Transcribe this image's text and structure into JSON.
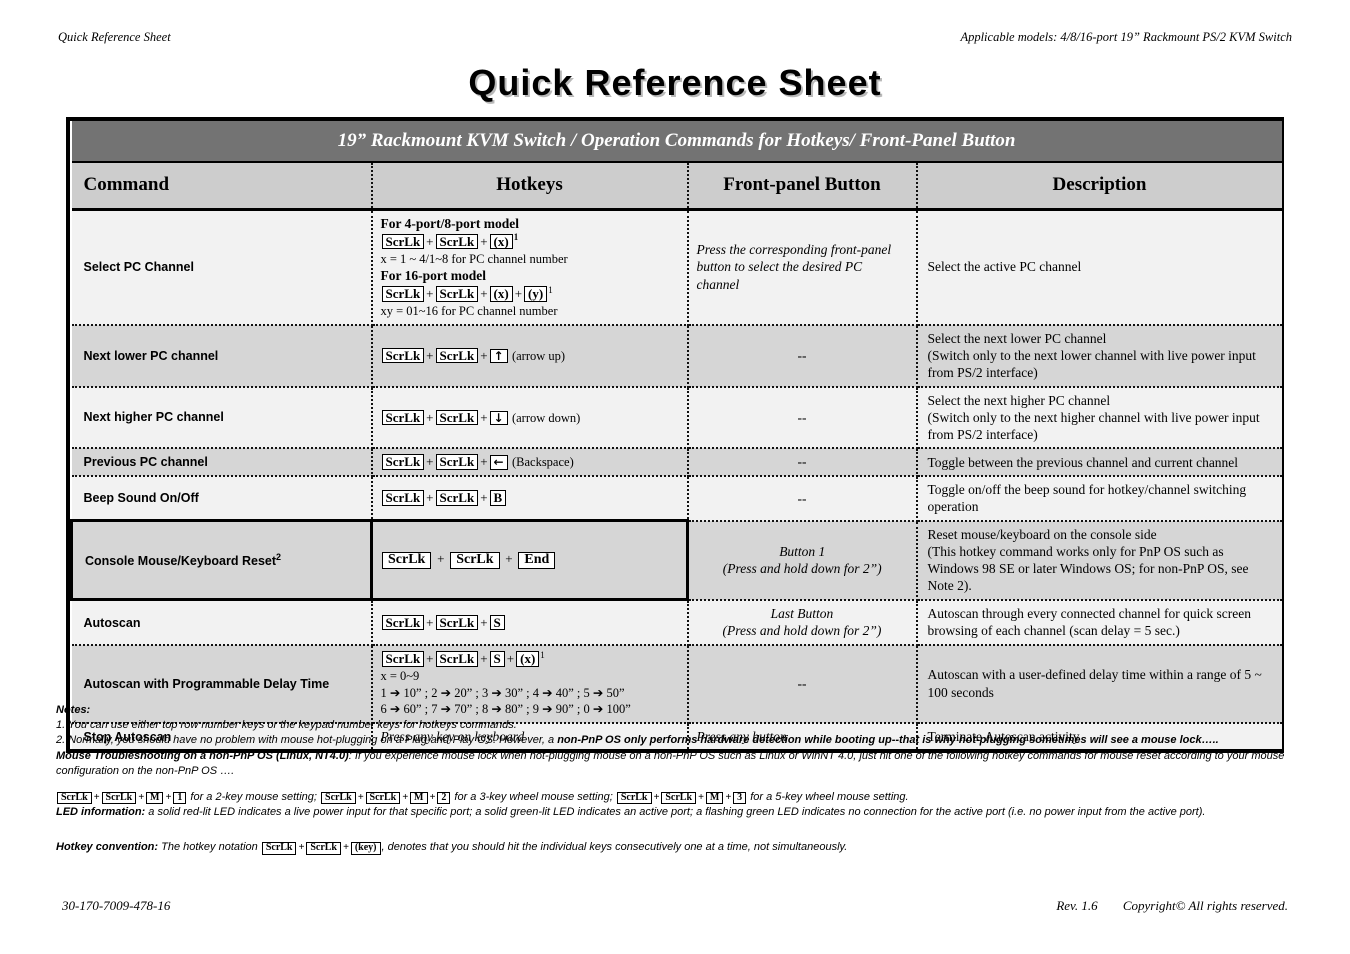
{
  "runhead": {
    "left": "Quick Reference Sheet",
    "right": "Applicable models: 4/8/16-port 19” Rackmount PS/2 KVM Switch"
  },
  "doc_title": "Quick   Reference   Sheet",
  "table": {
    "banner": "19” Rackmount KVM Switch  /  Operation   Commands for Hotkeys/  Front-Panel Button",
    "columns": [
      "Command",
      "Hotkeys",
      "Front-panel Button",
      "Description"
    ],
    "rows": [
      {
        "command": "Select PC Channel",
        "hotkeys": {
          "label1": "For 4-port/8-port model",
          "keys1": [
            "ScrLk",
            "ScrLk",
            "(x)"
          ],
          "sup1": "1",
          "note1": "x = 1 ~ 4/1~8  for PC channel number",
          "label2": "For 16-port model",
          "keys2": [
            "ScrLk",
            "ScrLk",
            "(x)",
            "(y)"
          ],
          "sup2": "1",
          "note2": "xy = 01~16  for PC channel number"
        },
        "front_panel": "Press the corresponding front-panel button  to select the desired PC channel",
        "front_panel_italic_part": "Press the corresponding",
        "description": "Select the active PC channel"
      },
      {
        "command": "Next lower PC channel",
        "keys": [
          "ScrLk",
          "ScrLk",
          "↑"
        ],
        "key_suffix": "(arrow up)",
        "front_panel": "--",
        "description": "Select the next lower PC channel\n(Switch only to the  next lower channel with live power input from PS/2 interface)"
      },
      {
        "command": "Next higher PC channel",
        "keys": [
          "ScrLk",
          "ScrLk",
          "↓"
        ],
        "key_suffix": "(arrow down)",
        "front_panel": "--",
        "description": "Select the next higher PC channel\n(Switch only to the  next higher channel with live power input from PS/2 interface)"
      },
      {
        "command": "Previous PC channel",
        "keys": [
          "ScrLk",
          "ScrLk",
          "←"
        ],
        "key_suffix": "(Backspace)",
        "front_panel": "--",
        "description": "Toggle between the previous channel and current channel"
      },
      {
        "command": "Beep Sound On/Off",
        "keys": [
          "ScrLk",
          "ScrLk",
          "B"
        ],
        "key_suffix": "",
        "front_panel": "--",
        "description": "Toggle on/off the beep sound for hotkey/channel switching operation"
      },
      {
        "command": "Console Mouse/Keyboard Reset",
        "command_sup": "2",
        "keys": [
          "ScrLk",
          "ScrLk",
          "End"
        ],
        "key_suffix": "",
        "front_panel": "Button 1",
        "front_panel2": "(Press and hold down for 2”)",
        "description": "Reset mouse/keyboard on the console side\n(This hotkey command works only for PnP OS such as Windows 98 SE or later Windows OS; for non-PnP OS, see Note 2)."
      },
      {
        "command": "Autoscan",
        "keys": [
          "ScrLk",
          "ScrLk",
          "S"
        ],
        "key_suffix": "",
        "front_panel": "Last Button",
        "front_panel2": "(Press and hold down for 2”)",
        "description": "Autoscan through every connected channel for quick screen browsing of each channel (scan delay = 5 sec.)"
      },
      {
        "command": "Autoscan with Programmable Delay Time",
        "keys": [
          "ScrLk",
          "ScrLk",
          "S",
          "(x)"
        ],
        "sup": "1",
        "note_a": "x =  0~9",
        "note_b": "1 ➔ 10”   ; 2 ➔ 20” ; 3 ➔ 30” ; 4 ➔ 40” ;  5 ➔ 50”",
        "note_c": "6 ➔ 60” ; 7 ➔ 70” ; 8 ➔ 80” ; 9 ➔ 90” ;  0 ➔ 100”",
        "front_panel": "--",
        "description": "Autoscan with a user-defined delay time within a range of 5 ~ 100 seconds"
      },
      {
        "command": "Stop Autoscan",
        "hotkeys_text": "Press any key on keyboard",
        "front_panel": "Press any button",
        "description": "Terminate Autoscan activity"
      }
    ]
  },
  "notes": {
    "title": "Notes:",
    "note1": "1. You can use either top row number keys or the keypad number keys for hotkeys commands.",
    "note2_a": "2. Normally, you should have no problem with mouse hot-plugging on a Plug-and-Play OS.  However, a ",
    "note2_b": "non-PnP OS only performs hardware detection while booting up--that is why hot-plugging sometimes will see a mouse lock…..",
    "troubleshoot_label": "Mouse Troubleshooting on a non-PnP OS (Linux, NT4.0)",
    "troubleshoot_text": ": If you experience mouse lock when hot-plugging mouse on a non-PnP OS such as Linux or WinNT 4.0, just hit one of the following hotkey commands for mouse reset according to your mouse configuration on the non-PnP OS ….",
    "mouse_settings": [
      {
        "keys": [
          "ScrLk",
          "ScrLk",
          "M",
          "1"
        ],
        "text": "for a 2-key mouse setting;"
      },
      {
        "keys": [
          "ScrLk",
          "ScrLk",
          "M",
          "2"
        ],
        "text": "for a 3-key wheel mouse setting;"
      },
      {
        "keys": [
          "ScrLk",
          "ScrLk",
          "M",
          "3"
        ],
        "text": "for a 5-key wheel mouse setting."
      }
    ],
    "led_label": "LED information:",
    "led_text": " a solid red-lit LED indicates a live power input for that specific port; a solid green-lit LED indicates an active port; a flashing green LED indicates no connection for the active port (i.e. no power input from the active port).",
    "convention_label": "Hotkey convention:",
    "convention_a": " The hotkey notation ",
    "convention_keys": [
      "ScrLk",
      "ScrLk",
      "(key)"
    ],
    "convention_b": ", denotes that you should hit the individual keys consecutively one at a time, not simultaneously."
  },
  "footer": {
    "part_number": "30-170-7009-478-16",
    "revision": "Rev. 1.6",
    "copyright": "Copyright© All rights reserved."
  }
}
